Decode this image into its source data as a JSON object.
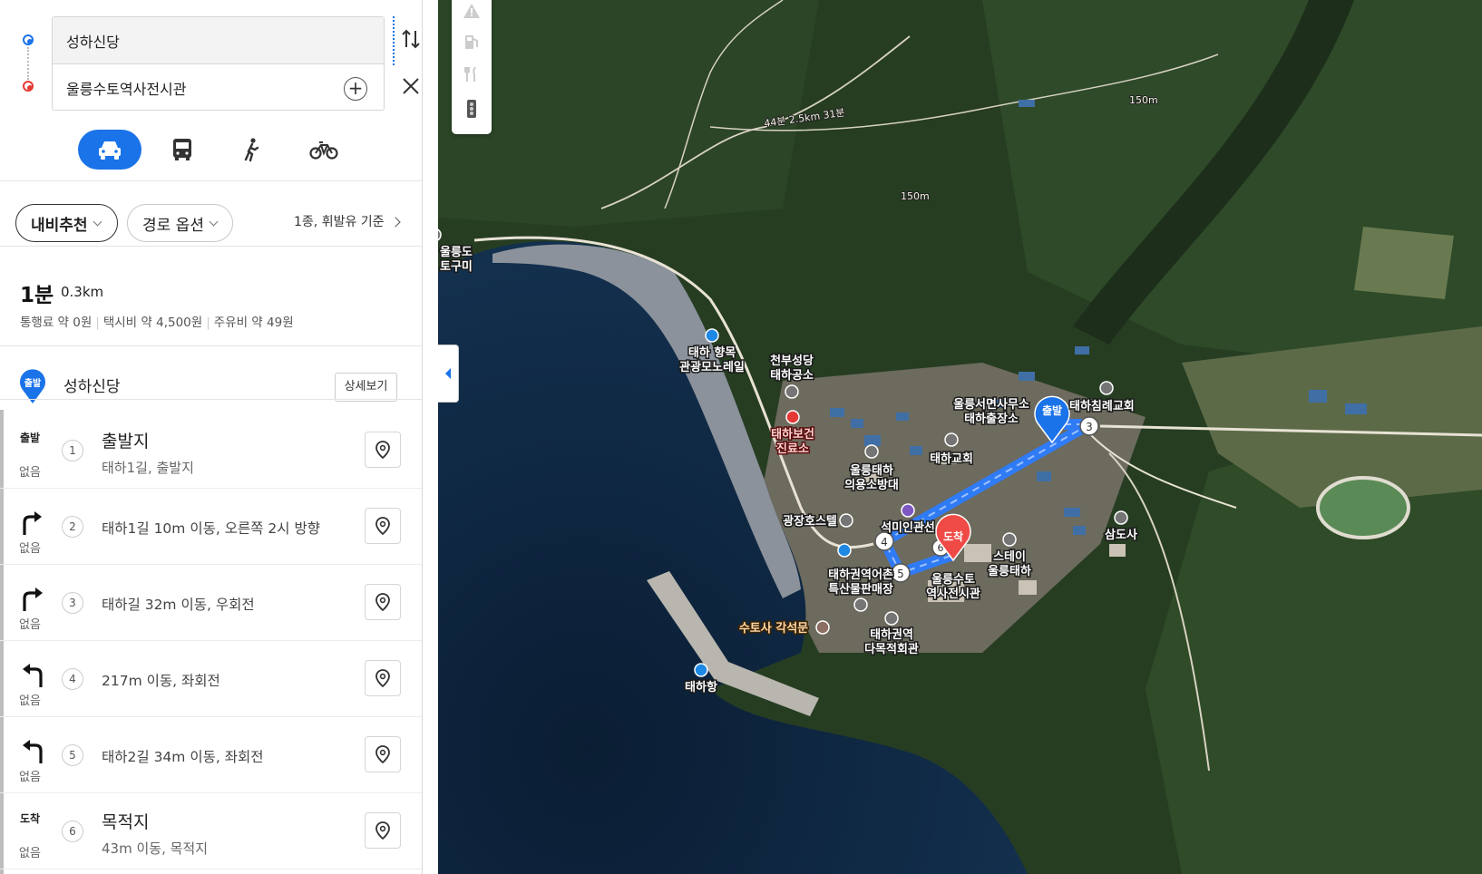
{
  "search": {
    "origin": "성하신당",
    "destination": "울릉수토역사전시관"
  },
  "transport_modes": [
    {
      "icon": "car-icon",
      "active": true
    },
    {
      "icon": "bus-icon",
      "active": false
    },
    {
      "icon": "walk-icon",
      "active": false
    },
    {
      "icon": "bike-icon",
      "active": false
    }
  ],
  "options": {
    "nav_label": "내비추천",
    "route_options_label": "경로 옵션",
    "fuel_basis": "1종, 휘발유 기준"
  },
  "summary": {
    "time": "1분",
    "distance": "0.3km",
    "toll": "통행료 약 0원",
    "taxi": "택시비 약 4,500원",
    "fuel": "주유비 약 49원"
  },
  "origin_row": {
    "badge": "출발",
    "name": "성하신당",
    "detail_button": "상세보기"
  },
  "steps": [
    {
      "num": "1",
      "icon_text": "출발",
      "turn": "start",
      "none": "없음",
      "title": "출발지",
      "sub": "태하1길, 출발지"
    },
    {
      "num": "2",
      "icon_text": "",
      "turn": "right-up",
      "none": "없음",
      "text": "태하1길 10m 이동, 오른쪽 2시 방향"
    },
    {
      "num": "3",
      "icon_text": "",
      "turn": "right",
      "none": "없음",
      "text": "태하길 32m 이동, 우회전"
    },
    {
      "num": "4",
      "icon_text": "",
      "turn": "left",
      "none": "없음",
      "text": "217m 이동, 좌회전"
    },
    {
      "num": "5",
      "icon_text": "",
      "turn": "left",
      "none": "없음",
      "text": "태하2길 34m 이동, 좌회전"
    },
    {
      "num": "6",
      "icon_text": "도착",
      "turn": "end",
      "none": "없음",
      "title": "목적지",
      "sub": "43m 이동, 목적지"
    }
  ],
  "map": {
    "start_marker": "출발",
    "end_marker": "도착",
    "route_color": "#2f7bf5",
    "waypoints": [
      "3",
      "4",
      "5",
      "6"
    ],
    "labels": {
      "port_monorail_1": "태하 향목",
      "port_monorail_2": "관광모노레일",
      "church_1": "천부성당",
      "church_2": "태하공소",
      "clinic_1": "태하보건",
      "clinic_2": "진료소",
      "office_1": "울릉서면사무소",
      "office_2": "태하출장소",
      "taeha_church_big": "태하침례교회",
      "taeha_church": "태하교회",
      "fire_1": "울릉태하",
      "fire_2": "의용소방대",
      "hotel": "광장호스텔",
      "inn": "석미인관선",
      "stay_1": "스테이",
      "stay_2": "울릉태하",
      "samdosa": "삼도사",
      "market_1": "태하권역어촌",
      "market_2": "특산물판매장",
      "museum_1": "울릉수토",
      "museum_2": "역사전시관",
      "multihall_1": "태하권역",
      "multihall_2": "다목적회관",
      "sutosa": "수토사 각석문",
      "taeha_port": "태하항",
      "ulleung_1": "울릉도",
      "ulleung_2": "토구미",
      "elev_1": "150m",
      "elev_2": "150m",
      "trail": "44분 2.5km 31분"
    }
  },
  "colors": {
    "accent": "#1a73e8",
    "origin_dot": "#1a73e8",
    "dest_dot": "#e53935"
  }
}
